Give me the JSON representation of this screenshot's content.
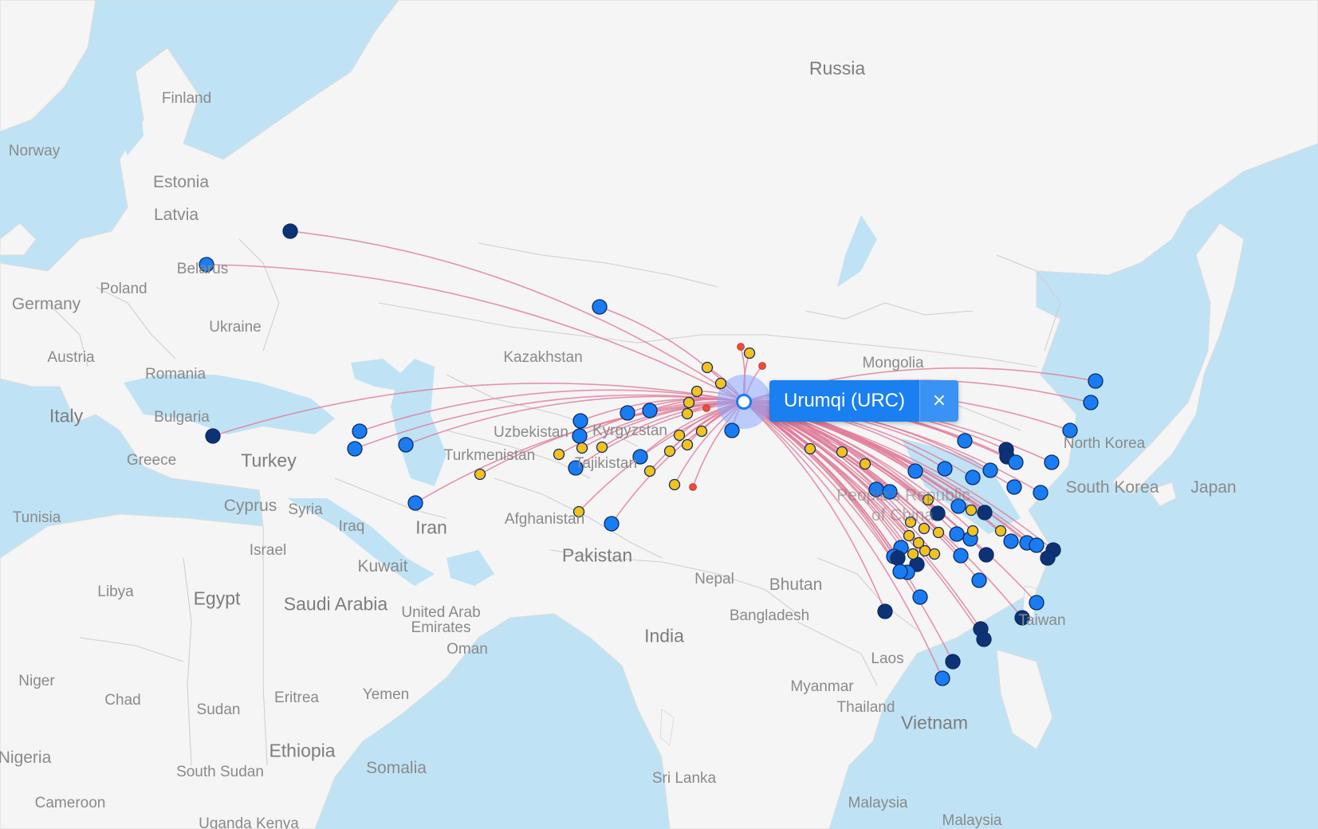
{
  "map": {
    "hub": {
      "name": "Urumqi (URC)",
      "close_label": "×"
    },
    "colors": {
      "water": "#bfe3f5",
      "land": "#f5f5f5",
      "border": "#cfcfcf",
      "route": "#e07a98",
      "hub_halo": "#8aa8ff",
      "dest_dark": "#0d3275",
      "dest_blue": "#1a7cf2",
      "dest_yellow": "#f4c21c",
      "dest_red": "#e74c3c"
    },
    "labels": [
      {
        "text": "Russia",
        "size": "l"
      },
      {
        "text": "Finland",
        "size": "s"
      },
      {
        "text": "Norway",
        "size": "s"
      },
      {
        "text": "Estonia",
        "size": "m"
      },
      {
        "text": "Latvia",
        "size": "m"
      },
      {
        "text": "Belarus",
        "size": "s"
      },
      {
        "text": "Poland",
        "size": "s"
      },
      {
        "text": "Germany",
        "size": "m"
      },
      {
        "text": "Ukraine",
        "size": "s"
      },
      {
        "text": "Austria",
        "size": "s"
      },
      {
        "text": "Romania",
        "size": "s"
      },
      {
        "text": "Italy",
        "size": "l"
      },
      {
        "text": "Bulgaria",
        "size": "s"
      },
      {
        "text": "Greece",
        "size": "s"
      },
      {
        "text": "Turkey",
        "size": "l"
      },
      {
        "text": "Cyprus",
        "size": "m"
      },
      {
        "text": "Syria",
        "size": "s"
      },
      {
        "text": "Iraq",
        "size": "s"
      },
      {
        "text": "Israel",
        "size": "s"
      },
      {
        "text": "Tunisia",
        "size": "s"
      },
      {
        "text": "Libya",
        "size": "s"
      },
      {
        "text": "Egypt",
        "size": "l"
      },
      {
        "text": "Kuwait",
        "size": "m"
      },
      {
        "text": "Saudi Arabia",
        "size": "l"
      },
      {
        "text": "United Arab",
        "size": "s"
      },
      {
        "text": "Emirates",
        "size": "s"
      },
      {
        "text": "Oman",
        "size": "s"
      },
      {
        "text": "Iran",
        "size": "l"
      },
      {
        "text": "Kazakhstan",
        "size": "s"
      },
      {
        "text": "Uzbekistan",
        "size": "s"
      },
      {
        "text": "Kyrgyzstan",
        "size": "s"
      },
      {
        "text": "Turkmenistan",
        "size": "s"
      },
      {
        "text": "Tajikistan",
        "size": "s"
      },
      {
        "text": "Afghanistan",
        "size": "s"
      },
      {
        "text": "Pakistan",
        "size": "l"
      },
      {
        "text": "Nepal",
        "size": "s"
      },
      {
        "text": "Bhutan",
        "size": "m"
      },
      {
        "text": "Bangladesh",
        "size": "s"
      },
      {
        "text": "India",
        "size": "l"
      },
      {
        "text": "Mongolia",
        "size": "s"
      },
      {
        "text": "North Korea",
        "size": "s"
      },
      {
        "text": "South Korea",
        "size": "m"
      },
      {
        "text": "Japan",
        "size": "m"
      },
      {
        "text": "Taiwan",
        "size": "s"
      },
      {
        "text": "People's Republic",
        "size": "m"
      },
      {
        "text": "of China",
        "size": "m"
      },
      {
        "text": "Laos",
        "size": "s"
      },
      {
        "text": "Myanmar",
        "size": "s"
      },
      {
        "text": "Thailand",
        "size": "s"
      },
      {
        "text": "Vietnam",
        "size": "l"
      },
      {
        "text": "Sri Lanka",
        "size": "s"
      },
      {
        "text": "Malaysia",
        "size": "s"
      },
      {
        "text": "Malaysia",
        "size": "s"
      },
      {
        "text": "Yemen",
        "size": "s"
      },
      {
        "text": "Eritrea",
        "size": "s"
      },
      {
        "text": "Sudan",
        "size": "s"
      },
      {
        "text": "Chad",
        "size": "s"
      },
      {
        "text": "Niger",
        "size": "s"
      },
      {
        "text": "Nigeria",
        "size": "m"
      },
      {
        "text": "Ethiopia",
        "size": "l"
      },
      {
        "text": "Somalia",
        "size": "m"
      },
      {
        "text": "South Sudan",
        "size": "s"
      },
      {
        "text": "Cameroon",
        "size": "s"
      },
      {
        "text": "Uganda Kenya",
        "size": "s"
      }
    ]
  }
}
